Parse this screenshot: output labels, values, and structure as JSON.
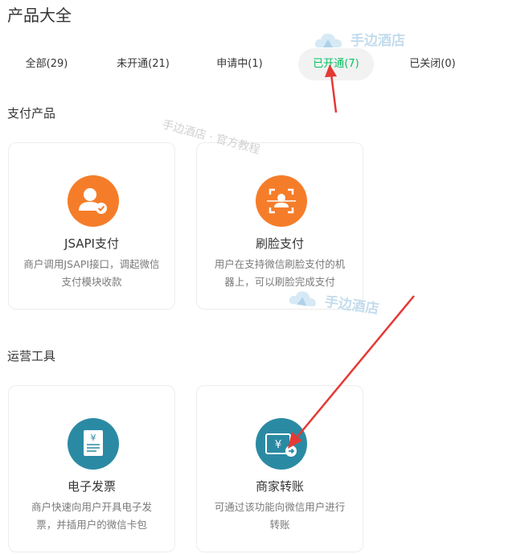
{
  "page": {
    "title": "产品大全"
  },
  "tabs": [
    {
      "label": "全部(29)",
      "active": false
    },
    {
      "label": "未开通(21)",
      "active": false
    },
    {
      "label": "申请中(1)",
      "active": false
    },
    {
      "label": "已开通(7)",
      "active": true
    },
    {
      "label": "已关闭(0)",
      "active": false
    }
  ],
  "sections": [
    {
      "title": "支付产品",
      "cards": [
        {
          "icon": "user-verified-icon",
          "title": "JSAPI支付",
          "desc": "商户调用JSAPI接口，调起微信支付模块收款"
        },
        {
          "icon": "face-scan-icon",
          "title": "刷脸支付",
          "desc": "用户在支持微信刷脸支付的机器上，可以刷脸完成支付"
        }
      ]
    },
    {
      "title": "运营工具",
      "cards": [
        {
          "icon": "invoice-icon",
          "title": "电子发票",
          "desc": "商户快速向用户开具电子发票，并插用户的微信卡包"
        },
        {
          "icon": "transfer-icon",
          "title": "商家转账",
          "desc": "可通过该功能向微信用户进行转账"
        }
      ]
    }
  ],
  "watermarks": {
    "brand": "手边酒店",
    "caption": "手边酒店 · 官方教程"
  },
  "colors": {
    "accent": "#07c160",
    "orange_icon": "#f57d2a",
    "teal_icon": "#2b8aa3",
    "arrow": "#e53935"
  }
}
